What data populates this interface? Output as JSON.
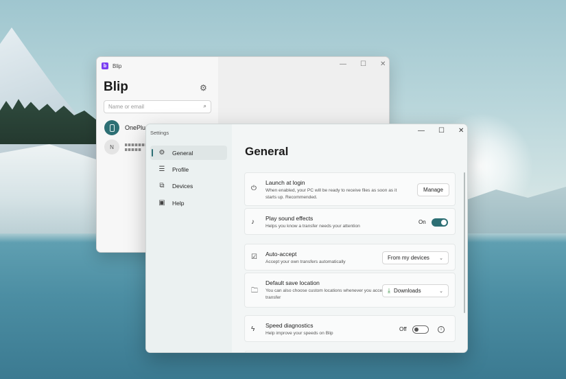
{
  "blip_window": {
    "app_name": "Blip",
    "heading": "Blip",
    "search_placeholder": "Name or email",
    "contacts": [
      {
        "name": "OnePlus",
        "avatar": "phone-icon"
      },
      {
        "name": "",
        "avatar_letter": "N"
      }
    ],
    "controls": {
      "minimize": "—",
      "maximize": "☐",
      "close": "✕"
    }
  },
  "settings_window": {
    "window_title": "Settings",
    "controls": {
      "minimize": "—",
      "maximize": "☐",
      "close": "✕"
    },
    "nav": [
      {
        "label": "General",
        "icon": "gear-icon",
        "glyph": "⚙",
        "active": true
      },
      {
        "label": "Profile",
        "icon": "profile-icon",
        "glyph": "☰",
        "active": false
      },
      {
        "label": "Devices",
        "icon": "devices-icon",
        "glyph": "⧉",
        "active": false
      },
      {
        "label": "Help",
        "icon": "help-icon",
        "glyph": "▣",
        "active": false
      }
    ],
    "page_title": "General",
    "settings": {
      "launch": {
        "title": "Launch at login",
        "desc": "When enabled, your PC will be ready to receive files as soon as it starts up. Recommended.",
        "button": "Manage"
      },
      "sound": {
        "title": "Play sound effects",
        "desc": "Helps you know a transfer needs your attention",
        "state_label": "On",
        "enabled": true
      },
      "accept": {
        "title": "Auto-accept",
        "desc": "Accept your own transfers automatically",
        "value": "From my devices"
      },
      "save": {
        "title": "Default save location",
        "desc": "You can also choose custom locations whenever you accept a transfer",
        "value": "Downloads"
      },
      "speed": {
        "title": "Speed diagnostics",
        "desc": "Help improve your speeds on Blip",
        "state_label": "Off",
        "enabled": false
      }
    }
  },
  "colors": {
    "accent": "#2d6f74",
    "brand": "#7b3ff2"
  }
}
